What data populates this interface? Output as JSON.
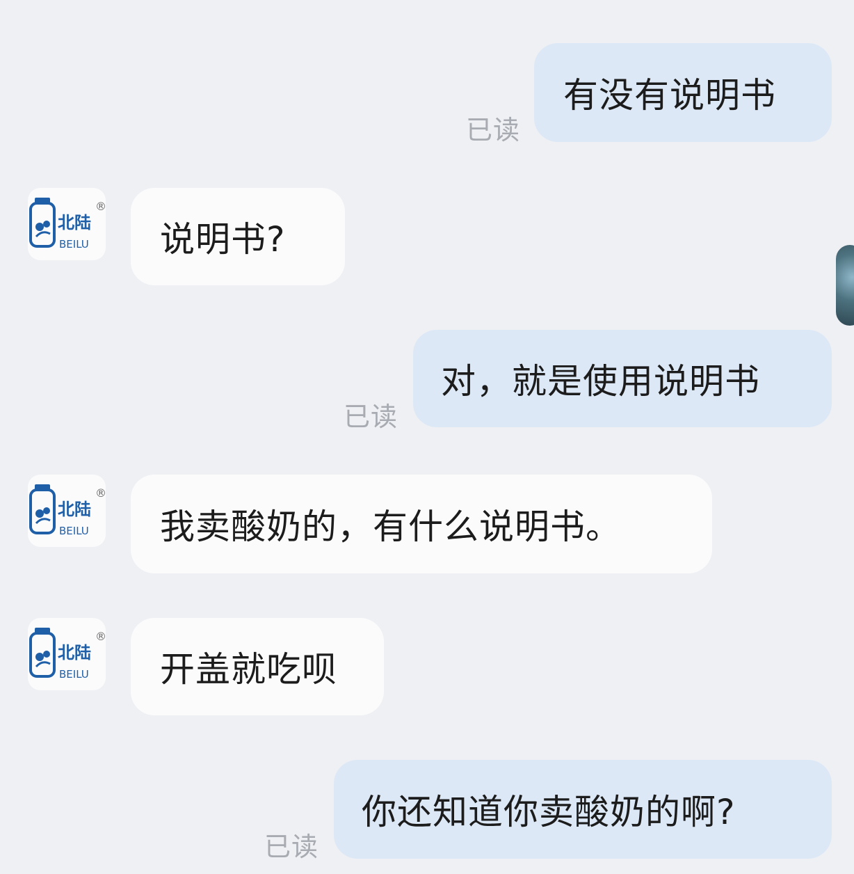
{
  "colors": {
    "background": "#eef0f4",
    "outgoing_bubble": "#dde8f6",
    "incoming_bubble": "#fbfbfc",
    "read_receipt": "#a8abb1",
    "brand_blue": "#1f5fa8"
  },
  "avatar": {
    "icon": "beilu-logo-icon",
    "brand_cn": "北陆",
    "brand_en": "BEILU",
    "registered": "®"
  },
  "messages": [
    {
      "direction": "out",
      "text": "有没有说明书",
      "status": "已读"
    },
    {
      "direction": "in",
      "text": "说明书?"
    },
    {
      "direction": "out",
      "text": "对，就是使用说明书",
      "status": "已读"
    },
    {
      "direction": "in",
      "text": "我卖酸奶的，有什么说明书。"
    },
    {
      "direction": "in",
      "text": "开盖就吃呗"
    },
    {
      "direction": "out",
      "text": "你还知道你卖酸奶的啊?",
      "status": "已读"
    }
  ]
}
